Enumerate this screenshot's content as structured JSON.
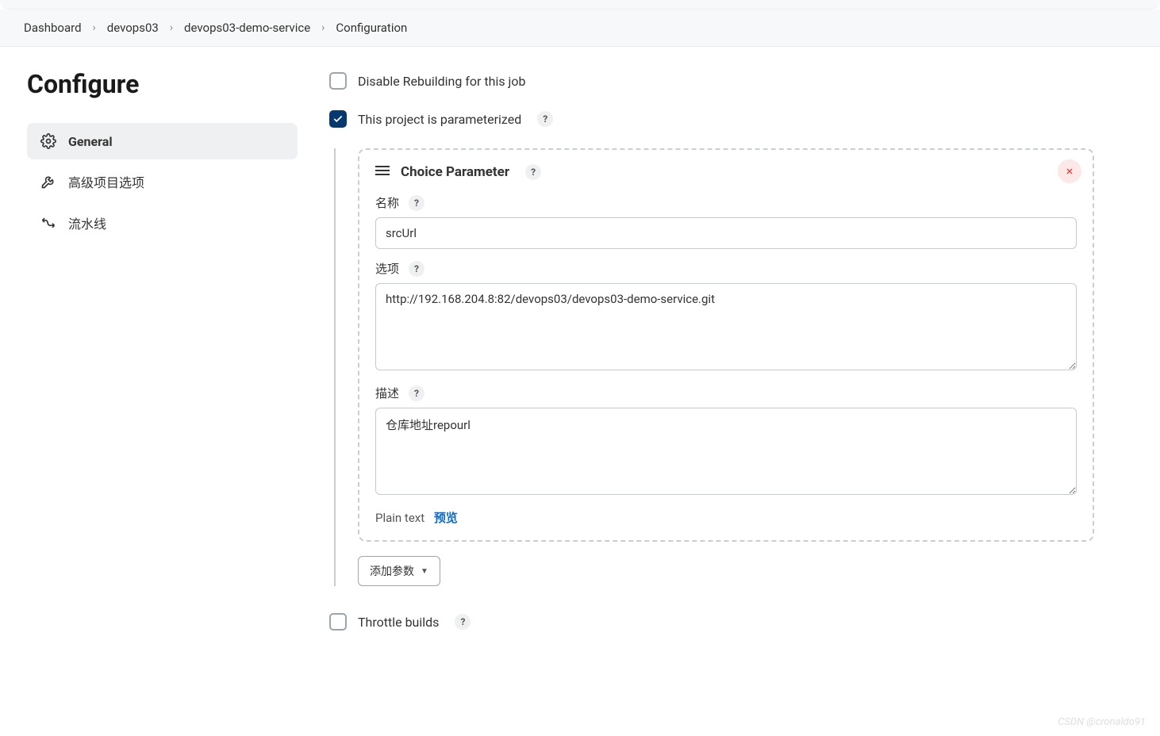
{
  "breadcrumb": {
    "items": [
      "Dashboard",
      "devops03",
      "devops03-demo-service",
      "Configuration"
    ]
  },
  "page": {
    "title": "Configure"
  },
  "sidebar": {
    "items": [
      {
        "label": "General",
        "active": true
      },
      {
        "label": "高级项目选项",
        "active": false
      },
      {
        "label": "流水线",
        "active": false
      }
    ]
  },
  "options": {
    "disable_rebuilding_label": "Disable Rebuilding for this job",
    "parameterized_label": "This project is parameterized",
    "throttle_label": "Throttle builds"
  },
  "parameter": {
    "type_title": "Choice Parameter",
    "name_label": "名称",
    "name_value": "srcUrl",
    "options_label": "选项",
    "options_value": "http://192.168.204.8:82/devops03/devops03-demo-service.git",
    "desc_label": "描述",
    "desc_value": "仓库地址repourl",
    "plain_text_label": "Plain text",
    "preview_label": "预览",
    "add_param_label": "添加参数"
  },
  "watermark": "CSDN @cronaldo91"
}
